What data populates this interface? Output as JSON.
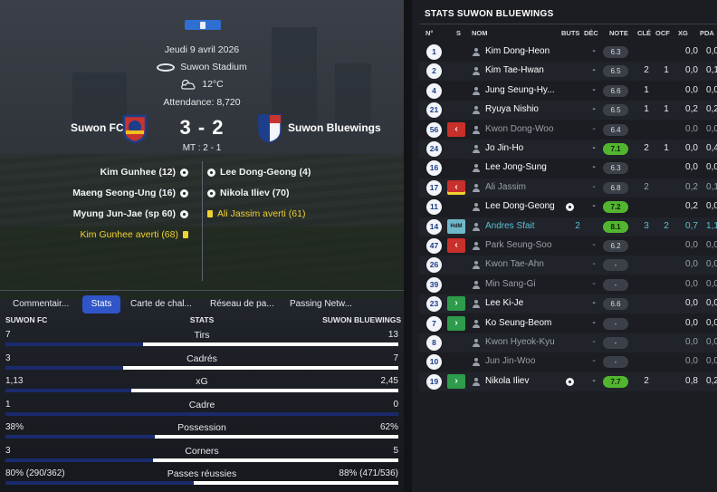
{
  "match": {
    "date": "Jeudi 9 avril 2026",
    "stadium": "Suwon Stadium",
    "temperature": "12°C",
    "attendance": "Attendance: 8,720",
    "home_team": "Suwon FC",
    "away_team": "Suwon Bluewings",
    "score": "3 - 2",
    "halftime": "MT : 2 - 1",
    "home_events": [
      {
        "text": "Kim Gunhee (12)",
        "type": "goal"
      },
      {
        "text": "Maeng Seong-Ung (16)",
        "type": "goal"
      },
      {
        "text": "Myung Jun-Jae (sp 60)",
        "type": "goal"
      },
      {
        "text": "Kim Gunhee averti (68)",
        "type": "yellow"
      }
    ],
    "away_events": [
      {
        "text": "Lee Dong-Geong (4)",
        "type": "goal"
      },
      {
        "text": "Nikola Iliev (70)",
        "type": "goal"
      },
      {
        "text": "Ali Jassim averti (61)",
        "type": "yellow"
      }
    ]
  },
  "tabs": [
    "Commentair...",
    "Stats",
    "Carte de chal...",
    "Réseau de pa...",
    "Passing Netw..."
  ],
  "active_tab": "Stats",
  "stats_header": {
    "home": "SUWON FC",
    "center": "STATS",
    "away": "SUWON BLUEWINGS"
  },
  "stats": [
    {
      "name": "Tirs",
      "home": "7",
      "away": "13",
      "home_share": 0.35
    },
    {
      "name": "Cadrés",
      "home": "3",
      "away": "7",
      "home_share": 0.3
    },
    {
      "name": "xG",
      "home": "1,13",
      "away": "2,45",
      "home_share": 0.32
    },
    {
      "name": "Cadre",
      "home": "1",
      "away": "0",
      "home_share": 1.0
    },
    {
      "name": "Possession",
      "home": "38%",
      "away": "62%",
      "home_share": 0.38
    },
    {
      "name": "Corners",
      "home": "3",
      "away": "5",
      "home_share": 0.375
    },
    {
      "name": "Passes réussies",
      "home": "80% (290/362)",
      "away": "88% (471/536)",
      "home_share": 0.48
    }
  ],
  "right_panel": {
    "title": "STATS SUWON BLUEWINGS",
    "columns": [
      "N°",
      "S",
      "NOM",
      "BUTS",
      "DÉC",
      "NOTE",
      "CLÉ",
      "OCF",
      "XG",
      "PDA"
    ],
    "players": [
      {
        "num": "1",
        "sub": "",
        "name": "Kim Dong-Heon",
        "style": "",
        "ball": false,
        "buts": "",
        "dec": "-",
        "note": "6.3",
        "note_good": false,
        "cle": "",
        "ocf": "",
        "xg": "0,0",
        "pda": "0,0"
      },
      {
        "num": "2",
        "sub": "",
        "name": "Kim Tae-Hwan",
        "style": "",
        "ball": false,
        "buts": "",
        "dec": "-",
        "note": "6.5",
        "note_good": false,
        "cle": "2",
        "ocf": "1",
        "xg": "0,0",
        "pda": "0,1"
      },
      {
        "num": "4",
        "sub": "",
        "name": "Jung Seung-Hy...",
        "style": "",
        "ball": false,
        "buts": "",
        "dec": "-",
        "note": "6.6",
        "note_good": false,
        "cle": "1",
        "ocf": "",
        "xg": "0,0",
        "pda": "0,0"
      },
      {
        "num": "21",
        "sub": "",
        "name": "Ryuya Nishio",
        "style": "",
        "ball": false,
        "buts": "",
        "dec": "-",
        "note": "6.5",
        "note_good": false,
        "cle": "1",
        "ocf": "1",
        "xg": "0,2",
        "pda": "0,2"
      },
      {
        "num": "56",
        "sub": "out",
        "name": "Kwon Dong-Woo",
        "style": "dim",
        "ball": false,
        "buts": "",
        "dec": "-",
        "note": "6.4",
        "note_good": false,
        "cle": "",
        "ocf": "",
        "xg": "0,0",
        "pda": "0,0"
      },
      {
        "num": "24",
        "sub": "",
        "name": "Jo Jin-Ho",
        "style": "",
        "ball": false,
        "buts": "",
        "dec": "-",
        "note": "7.1",
        "note_good": true,
        "cle": "2",
        "ocf": "1",
        "xg": "0,0",
        "pda": "0,4"
      },
      {
        "num": "16",
        "sub": "",
        "name": "Lee Jong-Sung",
        "style": "",
        "ball": false,
        "buts": "",
        "dec": "-",
        "note": "6.3",
        "note_good": false,
        "cle": "",
        "ocf": "",
        "xg": "0,0",
        "pda": "0,0"
      },
      {
        "num": "17",
        "sub": "out-y",
        "name": "Ali Jassim",
        "style": "dim",
        "ball": false,
        "buts": "",
        "dec": "-",
        "note": "6.8",
        "note_good": false,
        "cle": "2",
        "ocf": "",
        "xg": "0,2",
        "pda": "0,1"
      },
      {
        "num": "11",
        "sub": "",
        "name": "Lee Dong-Geong",
        "style": "",
        "ball": true,
        "buts": "",
        "dec": "-",
        "note": "7.2",
        "note_good": true,
        "cle": "",
        "ocf": "",
        "xg": "0,2",
        "pda": "0,0"
      },
      {
        "num": "14",
        "sub": "hdm",
        "name": "Andres Sfait",
        "style": "hl",
        "ball": false,
        "buts": "2",
        "dec": "",
        "note": "8.1",
        "note_good": true,
        "cle": "3",
        "ocf": "2",
        "xg": "0,7",
        "pda": "1,1"
      },
      {
        "num": "47",
        "sub": "out",
        "name": "Park Seung-Soo",
        "style": "dim",
        "ball": false,
        "buts": "",
        "dec": "-",
        "note": "6.2",
        "note_good": false,
        "cle": "",
        "ocf": "",
        "xg": "0,0",
        "pda": "0,0"
      },
      {
        "num": "26",
        "sub": "",
        "name": "Kwon Tae-Ahn",
        "style": "dim",
        "ball": false,
        "buts": "",
        "dec": "-",
        "note": "-",
        "note_good": false,
        "cle": "",
        "ocf": "",
        "xg": "0,0",
        "pda": "0,0"
      },
      {
        "num": "39",
        "sub": "",
        "name": "Min Sang-Gi",
        "style": "dim",
        "ball": false,
        "buts": "",
        "dec": "-",
        "note": "-",
        "note_good": false,
        "cle": "",
        "ocf": "",
        "xg": "0,0",
        "pda": "0,0"
      },
      {
        "num": "23",
        "sub": "in",
        "name": "Lee Ki-Je",
        "style": "",
        "ball": false,
        "buts": "",
        "dec": "-",
        "note": "6.6",
        "note_good": false,
        "cle": "",
        "ocf": "",
        "xg": "0,0",
        "pda": "0,0"
      },
      {
        "num": "7",
        "sub": "in",
        "name": "Ko Seung-Beom",
        "style": "",
        "ball": false,
        "buts": "",
        "dec": "-",
        "note": "-",
        "note_good": false,
        "cle": "",
        "ocf": "",
        "xg": "0,0",
        "pda": "0,0"
      },
      {
        "num": "8",
        "sub": "",
        "name": "Kwon Hyeok-Kyu",
        "style": "dim",
        "ball": false,
        "buts": "",
        "dec": "-",
        "note": "-",
        "note_good": false,
        "cle": "",
        "ocf": "",
        "xg": "0,0",
        "pda": "0,0"
      },
      {
        "num": "10",
        "sub": "",
        "name": "Jun Jin-Woo",
        "style": "dim",
        "ball": false,
        "buts": "",
        "dec": "-",
        "note": "-",
        "note_good": false,
        "cle": "",
        "ocf": "",
        "xg": "0,0",
        "pda": "0,0"
      },
      {
        "num": "19",
        "sub": "in",
        "name": "Nikola Iliev",
        "style": "",
        "ball": true,
        "buts": "",
        "dec": "-",
        "note": "7.7",
        "note_good": true,
        "cle": "2",
        "ocf": "",
        "xg": "0,8",
        "pda": "0,2"
      }
    ]
  },
  "colors": {
    "accent": "#2f55c9",
    "good_rating": "#52b52f",
    "sub_out": "#c9302c",
    "sub_in": "#2e9c4a",
    "yellow_card": "#f0d232"
  }
}
